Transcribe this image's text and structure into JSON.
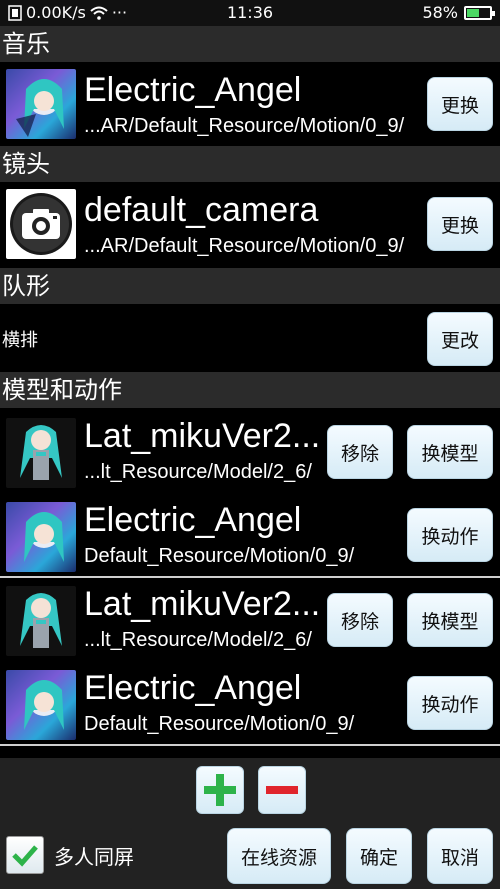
{
  "status_bar": {
    "speed": "0.00K/s",
    "more": "···",
    "time": "11:36",
    "battery_text": "58%",
    "battery_level": 0.58
  },
  "sections": {
    "music": "音乐",
    "camera": "镜头",
    "formation": "队形",
    "models": "模型和动作"
  },
  "music": {
    "title": "Electric_Angel",
    "path": "...AR/Default_Resource/Motion/0_9/",
    "button": "更换"
  },
  "camera": {
    "title": "default_camera",
    "path": "...AR/Default_Resource/Motion/0_9/",
    "button": "更换"
  },
  "formation": {
    "value": "横排",
    "button": "更改"
  },
  "performers": [
    {
      "model_title": "Lat_mikuVer2...",
      "model_path": "...lt_Resource/Model/2_6/",
      "remove_button": "移除",
      "change_model_button": "换模型",
      "motion_title": "Electric_Angel",
      "motion_path": "Default_Resource/Motion/0_9/",
      "change_motion_button": "换动作"
    },
    {
      "model_title": "Lat_mikuVer2...",
      "model_path": "...lt_Resource/Model/2_6/",
      "remove_button": "移除",
      "change_model_button": "换模型",
      "motion_title": "Electric_Angel",
      "motion_path": "Default_Resource/Motion/0_9/",
      "change_motion_button": "换动作"
    }
  ],
  "bottom": {
    "multi_screen_label": "多人同屏",
    "multi_screen_checked": true,
    "online_resources": "在线资源",
    "confirm": "确定",
    "cancel": "取消"
  },
  "colors": {
    "plus": "#2db34a",
    "minus": "#e0252c",
    "check": "#2db34a"
  }
}
